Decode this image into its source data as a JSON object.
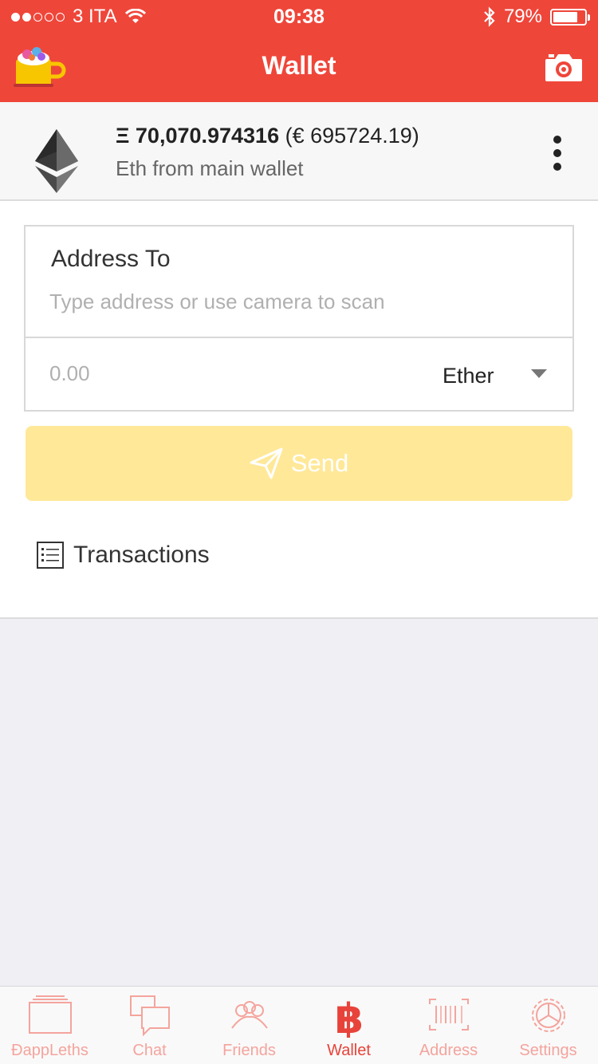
{
  "status_bar": {
    "carrier": "3 ITA",
    "time": "09:38",
    "battery": "79%",
    "battery_level": 0.79,
    "icons": [
      "signal-dots",
      "wifi-icon",
      "bluetooth-icon",
      "battery-icon"
    ]
  },
  "nav": {
    "title": "Wallet",
    "left_icon": "app-logo-cup",
    "right_icon": "camera-icon"
  },
  "account": {
    "symbol": "Ξ",
    "amount": "70,070.974316",
    "fiat": "(€ 695724.19)",
    "name": "Eth from main wallet",
    "icon": "ethereum-icon"
  },
  "form": {
    "address_label": "Address To",
    "address_placeholder": "Type address or use camera to scan",
    "address_value": "",
    "amount_placeholder": "0.00",
    "amount_value": "",
    "unit_selected": "Ether"
  },
  "send_button": {
    "label": "Send",
    "icon": "paper-plane-icon",
    "color": "#ffe898"
  },
  "transactions": {
    "label": "Transactions",
    "icon": "list-icon"
  },
  "tabs": [
    {
      "label": "ĐappLeths",
      "icon": "cards-icon",
      "active": false
    },
    {
      "label": "Chat",
      "icon": "chat-icon",
      "active": false
    },
    {
      "label": "Friends",
      "icon": "friends-icon",
      "active": false
    },
    {
      "label": "Wallet",
      "icon": "bitcoin-icon",
      "active": true
    },
    {
      "label": "Address",
      "icon": "barcode-icon",
      "active": false
    },
    {
      "label": "Settings",
      "icon": "settings-gear-icon",
      "active": false
    }
  ],
  "colors": {
    "header": "#ef463a",
    "active_tab": "#e8433a",
    "inactive_tab": "#f4a49d"
  }
}
